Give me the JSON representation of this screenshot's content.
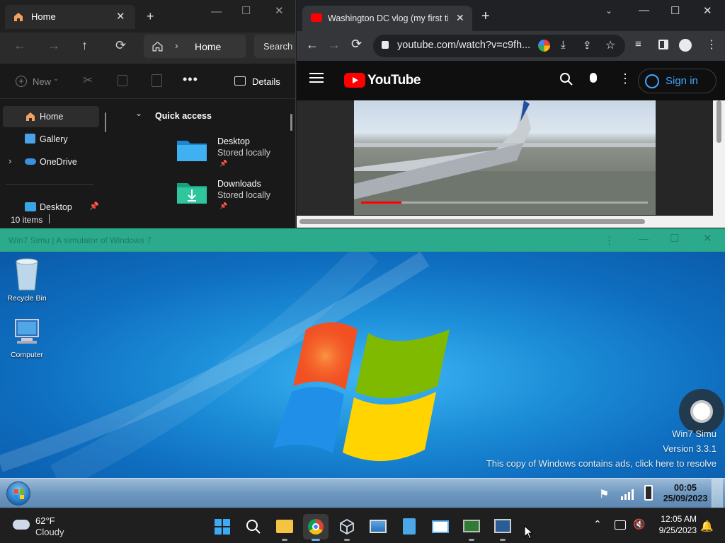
{
  "explorer": {
    "tab_title": "Home",
    "address_text": "Home",
    "search_placeholder": "Search",
    "new_label": "New",
    "details_label": "Details",
    "sidebar": [
      {
        "label": "Home"
      },
      {
        "label": "Gallery"
      },
      {
        "label": "OneDrive"
      },
      {
        "label": "Desktop"
      }
    ],
    "section_title": "Quick access",
    "folders": [
      {
        "name": "Desktop",
        "sub": "Stored locally"
      },
      {
        "name": "Downloads",
        "sub": "Stored locally"
      }
    ],
    "status": "10 items"
  },
  "chrome": {
    "tab_title": "Washington DC vlog (my first tim",
    "url": "youtube.com/watch?v=c9fh...",
    "youtube_logo_text": "YouTube",
    "sign_in_label": "Sign in",
    "video_progress": 0.14
  },
  "win7": {
    "window_title": "Win7 Simu | A simulator of Windows 7",
    "icons": [
      {
        "label": "Recycle Bin"
      },
      {
        "label": "Computer"
      }
    ],
    "info_line1": "Win7 Simu",
    "info_line2": "Version 3.3.1",
    "info_line3": "This copy of Windows contains ads, click here to resolve",
    "clock_time": "00:05",
    "clock_date": "25/09/2023"
  },
  "taskbar": {
    "weather_temp": "62°F",
    "weather_desc": "Cloudy",
    "time": "12:05 AM",
    "date": "9/25/2023"
  }
}
